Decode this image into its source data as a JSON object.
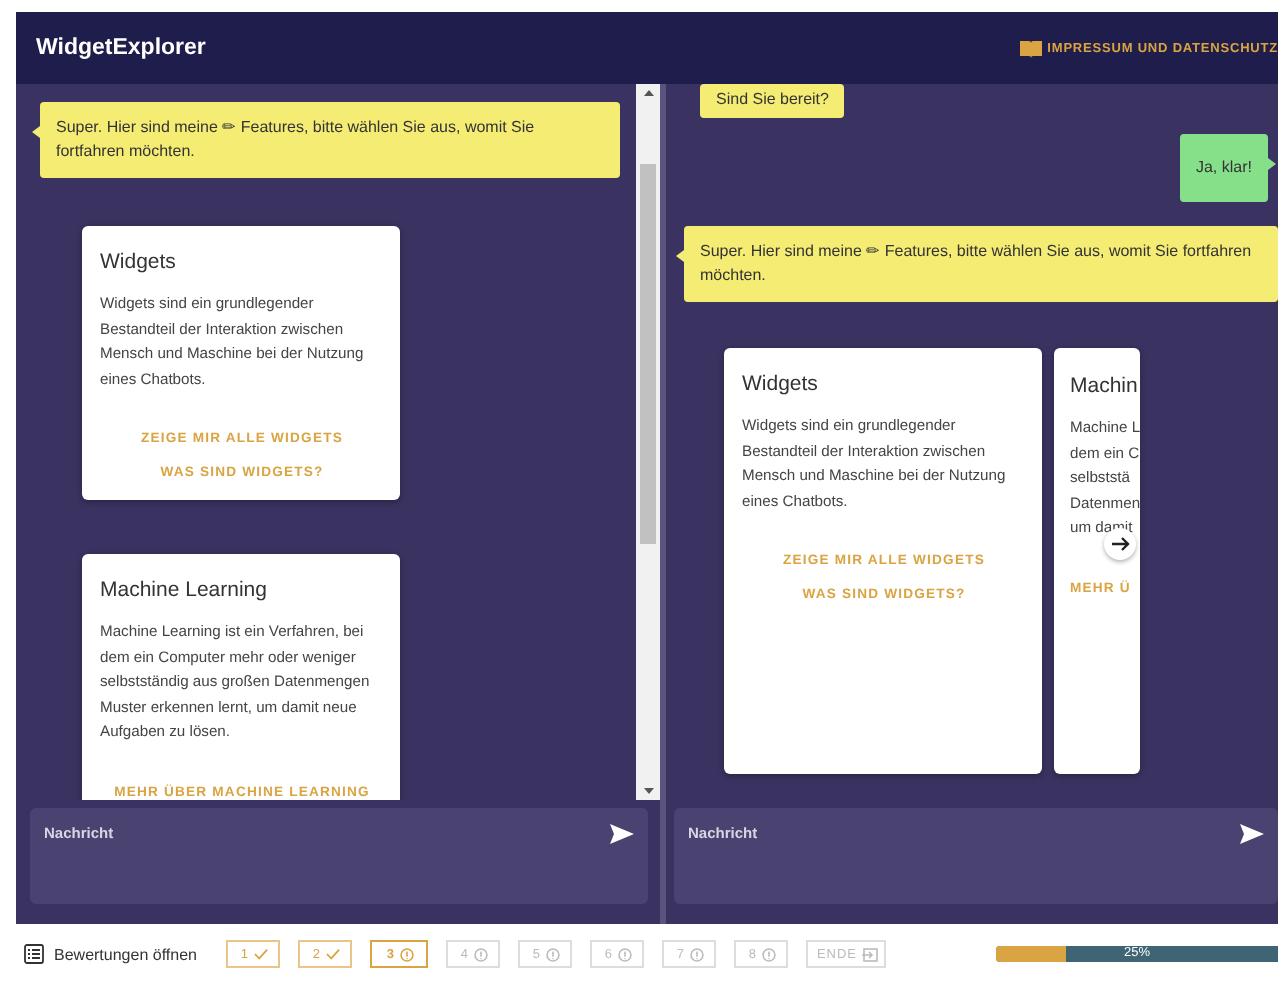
{
  "header": {
    "title": "WidgetExplorer",
    "link": "IMPRESSUM UND DATENSCHUTZ"
  },
  "left_chat": {
    "messages": [
      {
        "kind": "bot",
        "text": "Super. Hier sind meine ✏ Features, bitte wählen Sie aus, womit Sie fortfahren möchten."
      }
    ],
    "cards": [
      {
        "kind": "full",
        "title": "Widgets",
        "description": "Widgets sind ein grundlegender Bestandteil der Interaktion zwischen Mensch und Maschine bei der Nutzung eines Chatbots.",
        "actions": [
          "ZEIGE MIR ALLE WIDGETS",
          "WAS SIND WIDGETS?"
        ]
      },
      {
        "kind": "full",
        "title": "Machine Learning",
        "description": "Machine Learning ist ein Verfahren, bei dem ein Computer mehr oder weniger selbstständig aus großen Datenmengen Muster erkennen lernt, um damit neue Aufgaben zu lösen.",
        "actions": [
          "MEHR ÜBER MACHINE LEARNING"
        ]
      }
    ],
    "input": {
      "placeholder": "Nachricht"
    }
  },
  "right_chat": {
    "messages": [
      {
        "kind": "bot",
        "text": "Sind Sie bereit?"
      },
      {
        "kind": "user",
        "text": "Ja, klar!"
      },
      {
        "kind": "bot",
        "text": "Super. Hier sind meine ✏ Features, bitte wählen Sie aus, womit Sie fortfahren möchten."
      }
    ],
    "cards": [
      {
        "kind": "full",
        "title": "Widgets",
        "description": "Widgets sind ein grundlegender Bestandteil der Interaktion zwischen Mensch und Maschine bei der Nutzung eines Chatbots.",
        "actions": [
          "ZEIGE MIR ALLE WIDGETS",
          "WAS SIND WIDGETS?"
        ]
      },
      {
        "kind": "cut",
        "title": "Machin",
        "lines": [
          "Machine L",
          "dem ein C",
          "selbststä",
          "Datenmen",
          "um damit"
        ],
        "actions": [
          "MEHR Ü"
        ]
      }
    ],
    "input": {
      "placeholder": "Nachricht"
    }
  },
  "footer": {
    "ratings": "Bewertungen öffnen",
    "steps": [
      {
        "kind": "step",
        "label": "1",
        "done": true,
        "current": false
      },
      {
        "kind": "step",
        "label": "2",
        "done": true,
        "current": false
      },
      {
        "kind": "step",
        "label": "3",
        "done": false,
        "current": true
      },
      {
        "kind": "step",
        "label": "4",
        "done": false,
        "current": false
      },
      {
        "kind": "step",
        "label": "5",
        "done": false,
        "current": false
      },
      {
        "kind": "step",
        "label": "6",
        "done": false,
        "current": false
      },
      {
        "kind": "step",
        "label": "7",
        "done": false,
        "current": false
      },
      {
        "kind": "step",
        "label": "8",
        "done": false,
        "current": false
      },
      {
        "kind": "end",
        "label": "ENDE"
      }
    ],
    "progress": {
      "level": 0.25,
      "reading": "25%"
    }
  }
}
